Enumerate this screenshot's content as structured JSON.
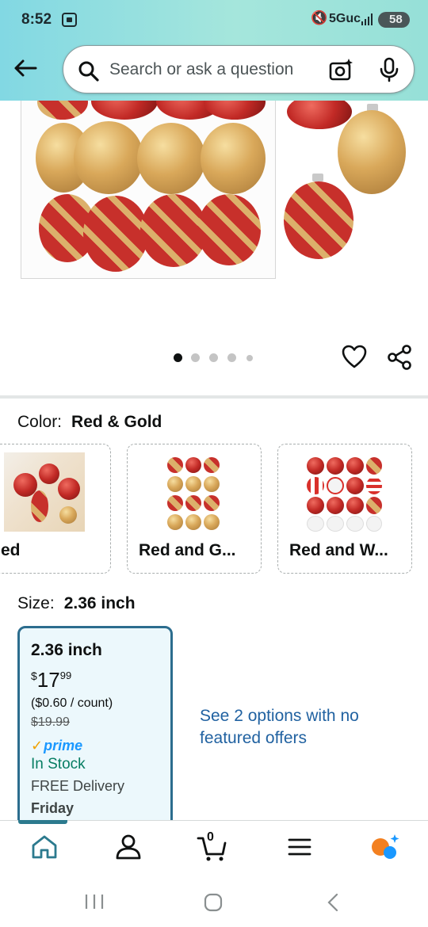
{
  "status_bar": {
    "time": "8:52",
    "network": "5Guc",
    "battery": "58"
  },
  "search": {
    "placeholder": "Search or ask a question"
  },
  "gallery": {
    "page_count": 5,
    "active_page": 1
  },
  "product": {
    "color_label": "Color:",
    "color_value": "Red & Gold",
    "color_options": [
      {
        "label": "ed"
      },
      {
        "label": "Red and G..."
      },
      {
        "label": "Red and W..."
      }
    ],
    "size_label": "Size:",
    "size_value": "2.36 inch",
    "size_card": {
      "title": "2.36 inch",
      "price_currency": "$",
      "price_whole": "17",
      "price_fraction": "99",
      "unit_price": "($0.60 / count)",
      "list_price": "$19.99",
      "prime": "prime",
      "stock": "In Stock",
      "delivery": "FREE Delivery",
      "delivery_day": "Friday"
    },
    "more_options": "See 2 options with no featured offers"
  },
  "nav": {
    "cart_count": "0",
    "items": [
      "home-icon",
      "account-icon",
      "cart-icon",
      "menu-icon",
      "rufus-icon"
    ]
  },
  "colors": {
    "accent_blue": "#2162a1",
    "stock_green": "#067d62",
    "selected_border": "#2c6d8e",
    "header_teal": "#82d8e3"
  }
}
